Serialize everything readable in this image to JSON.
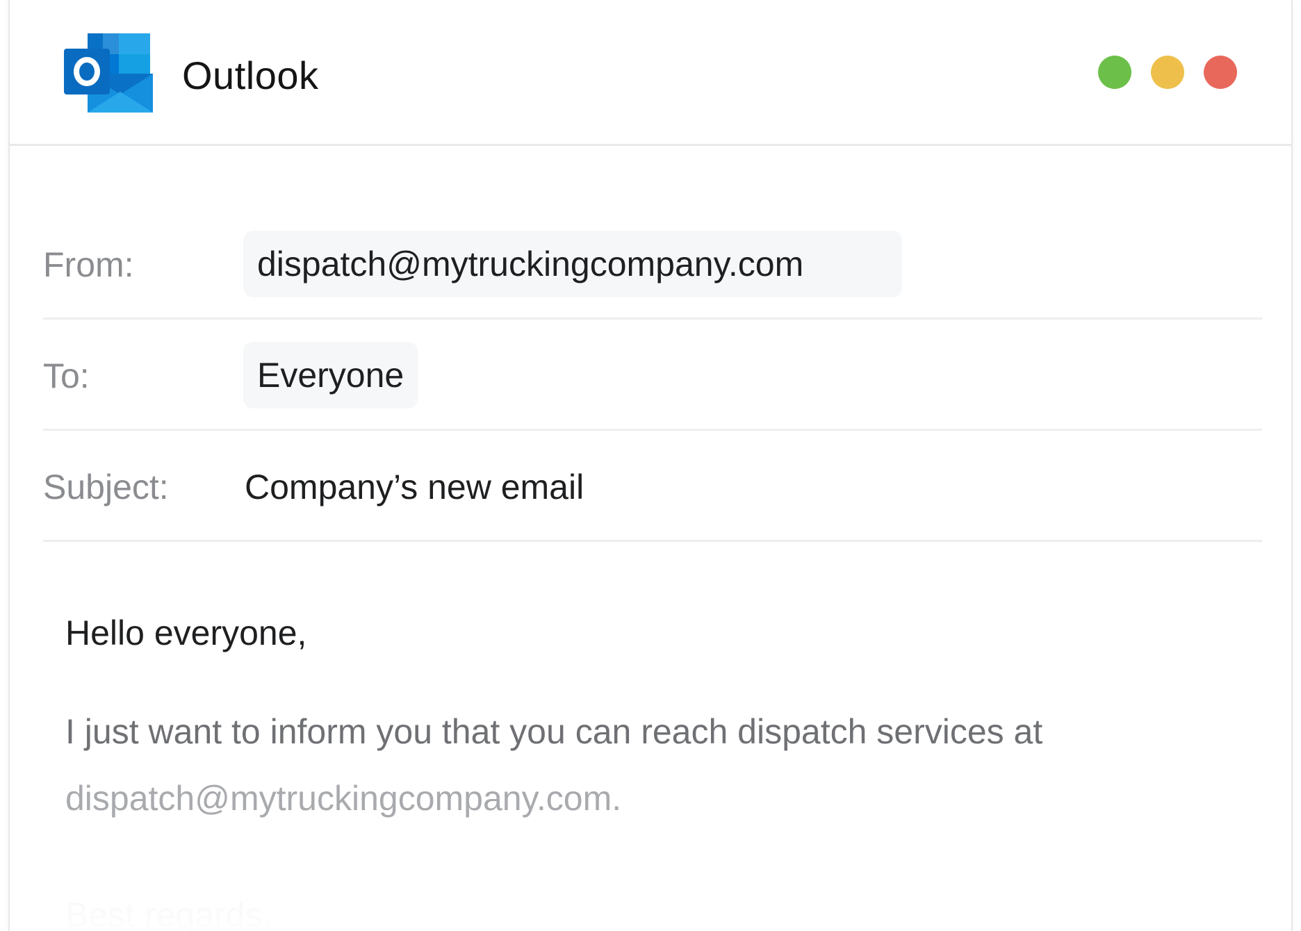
{
  "app": {
    "title": "Outlook",
    "icon": "outlook-logo"
  },
  "window_controls": {
    "green": "#6cc04a",
    "yellow": "#eec04b",
    "red": "#e8695c"
  },
  "fields": {
    "from": {
      "label": "From:",
      "value": "dispatch@mytruckingcompany.com"
    },
    "to": {
      "label": "To:",
      "value": "Everyone"
    },
    "subject": {
      "label": "Subject:",
      "value": "Company’s new email"
    }
  },
  "body": {
    "greeting": "Hello everyone,",
    "line1": "I just want to inform you that you can reach dispatch services at",
    "line2": "dispatch@mytruckingcompany.com.",
    "signoff": "Best regards,"
  },
  "colors": {
    "brand_blue": "#0a72c6",
    "brand_dark_blue": "#0358a7",
    "brand_light_blue": "#28a8ea"
  }
}
